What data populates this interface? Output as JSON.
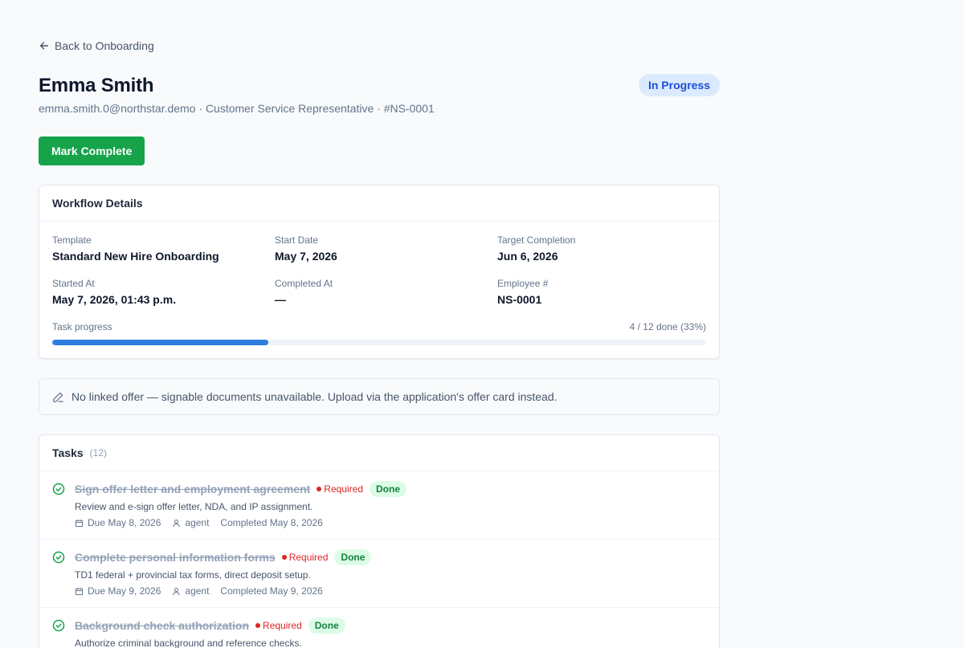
{
  "nav": {
    "back_label": "Back to Onboarding"
  },
  "employee": {
    "name": "Emma Smith",
    "subline": "emma.smith.0@northstar.demo · Customer Service Representative · #NS-0001",
    "status": "In Progress"
  },
  "actions": {
    "mark_complete": "Mark Complete"
  },
  "workflow": {
    "title": "Workflow Details",
    "fields": {
      "template": {
        "label": "Template",
        "value": "Standard New Hire Onboarding"
      },
      "start_date": {
        "label": "Start Date",
        "value": "May 7, 2026"
      },
      "target_completion": {
        "label": "Target Completion",
        "value": "Jun 6, 2026"
      },
      "started_at": {
        "label": "Started At",
        "value": "May 7, 2026, 01:43 p.m."
      },
      "completed_at": {
        "label": "Completed At",
        "value": "—"
      },
      "employee_number": {
        "label": "Employee #",
        "value": "NS-0001"
      }
    },
    "progress": {
      "label": "Task progress",
      "summary": "4 / 12 done (33%)",
      "fraction": 0.33
    }
  },
  "notice": {
    "text": "No linked offer — signable documents unavailable. Upload via the application's offer card instead."
  },
  "tasks": {
    "title": "Tasks",
    "count": "(12)",
    "items": [
      {
        "title": "Sign offer letter and employment agreement",
        "required": "Required",
        "status": "Done",
        "description": "Review and e-sign offer letter, NDA, and IP assignment.",
        "due": "Due May 8, 2026",
        "assignee": "agent",
        "completed": "Completed May 8, 2026"
      },
      {
        "title": "Complete personal information forms",
        "required": "Required",
        "status": "Done",
        "description": "TD1 federal + provincial tax forms, direct deposit setup.",
        "due": "Due May 9, 2026",
        "assignee": "agent",
        "completed": "Completed May 9, 2026"
      },
      {
        "title": "Background check authorization",
        "required": "Required",
        "status": "Done",
        "description": "Authorize criminal background and reference checks.",
        "due": "",
        "assignee": "",
        "completed": ""
      }
    ]
  },
  "colors": {
    "primary_green": "#16a34a",
    "status_blue_bg": "#dbeafe",
    "status_blue_text": "#1d4ed8",
    "progress_blue": "#2f7de1",
    "required_red": "#dc2626",
    "done_green_bg": "#dcfce7",
    "done_green_text": "#15803d"
  }
}
